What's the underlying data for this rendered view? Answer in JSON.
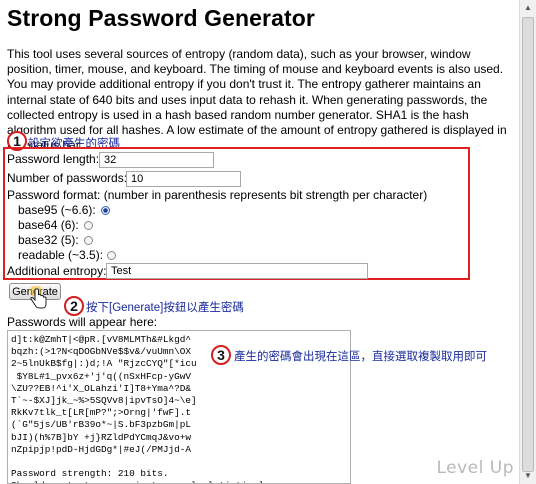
{
  "page": {
    "title": "Strong Password Generator",
    "intro": "This tool uses several sources of entropy (random data), such as your browser, window position, timer, mouse, and keyboard. The timing of mouse and keyboard events is also used. You may provide additional entropy if you don't trust it. The entropy gatherer maintains an internal state of 640 bits and uses input data to rehash it. When generating passwords, the collected entropy is used in a hash based random number generator. SHA1 is the hash algorithm used for all hashes. A low estimate of the amount of entropy gathered is displayed in the status bar."
  },
  "annotations": {
    "step1": {
      "number": "1",
      "text": "設定欲產生的密碼"
    },
    "step2": {
      "number": "2",
      "text": "按下[Generate]按鈕以產生密碼"
    },
    "step3": {
      "number": "3",
      "text": "產生的密碼會出現在這區，直接選取複製取用即可"
    }
  },
  "form": {
    "length_label": "Password length:",
    "length_value": "32",
    "count_label": "Number of passwords:",
    "count_value": "10",
    "format_label": "Password format: (number in parenthesis represents bit strength per character)",
    "formats": [
      {
        "label": "base95 (~6.6):",
        "checked": true
      },
      {
        "label": "base64 (6):",
        "checked": false
      },
      {
        "label": "base32 (5):",
        "checked": false
      },
      {
        "label": "readable (~3.5):",
        "checked": false
      }
    ],
    "entropy_label": "Additional entropy:",
    "entropy_value": "Test",
    "generate_label": "Generate"
  },
  "output": {
    "label": "Passwords will appear here:",
    "text": "d]t:k@ZmhT|<@pR.[vV8MLMTh&#Lkgd^\nbqzh:(>1?N<qDOGbNVe$$v&/vuUmn\\OX\n2~5lnUkB$fg|:)d;!A \"RjzcCYQ\"[*icu\n $Y8L#1_pvx6z+'j'q((nSxHFcp-yGwV\n\\ZU??EB!^i'X_OLahzi'I]T8+Yma^?D&\nT`~-$XJ]jk_~%>5SQVv8|ipvTsO]4~\\e]\nRkKv7tlk_t[LR[mP?\";>Orng|'fwF].t\n(`G\"5js/UB'rB39o*~|S.bF3pzbGm|pL\nbJI)(h%7B]bY +j}RZldPdYCmqJ&vo+w\nnZpipjp!pdD-HjdGDg*|#eJ(/PMJjd-A\n\nPassword strength: 210 bits.\nShould protect you against manual clatistical",
    "strength": "Password strength: 210 bits."
  },
  "watermark": "Level Up"
}
